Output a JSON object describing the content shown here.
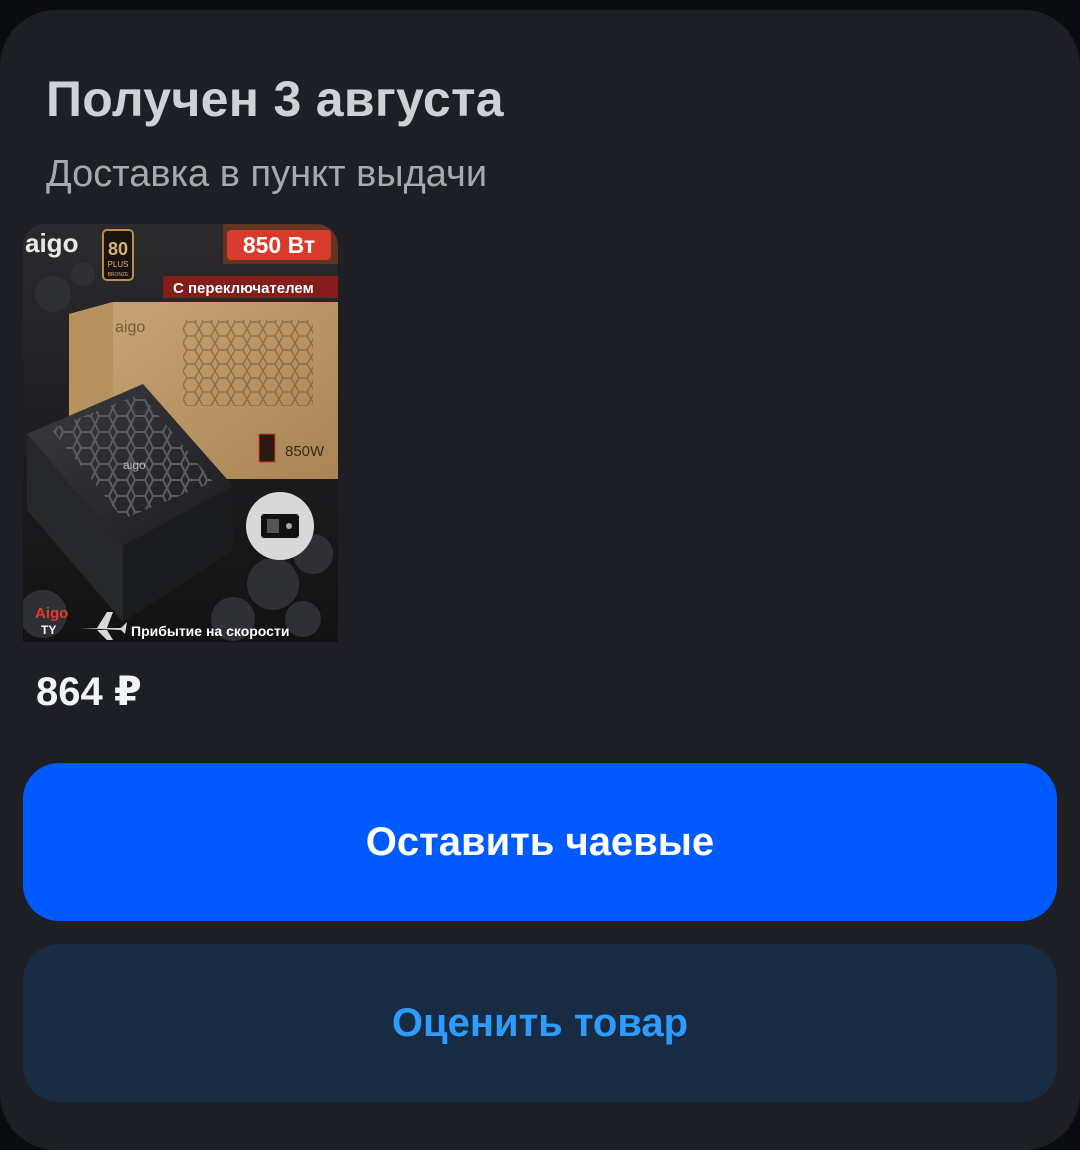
{
  "order": {
    "status_title": "Получен 3 августа",
    "delivery_method": "Доставка в пункт выдачи"
  },
  "product": {
    "image_texts": {
      "brand": "aigo",
      "badge": "80",
      "badge_sub": "PLUS",
      "badge_tier": "BRONZE",
      "power": "850 Вт",
      "switch_caption": "С переключателем",
      "box_brand": "aigo",
      "box_power": "850W",
      "store_name": "Aigo",
      "store_suffix": "TY",
      "shipping_note": "Прибытие на скорости"
    },
    "price": "864 ₽"
  },
  "actions": {
    "tip_label": "Оставить чаевые",
    "rate_label": "Оценить товар"
  },
  "colors": {
    "card_bg": "#1d1f24",
    "primary_button": "#005bff",
    "secondary_button": "#172b42",
    "secondary_text": "#2f9bff"
  }
}
